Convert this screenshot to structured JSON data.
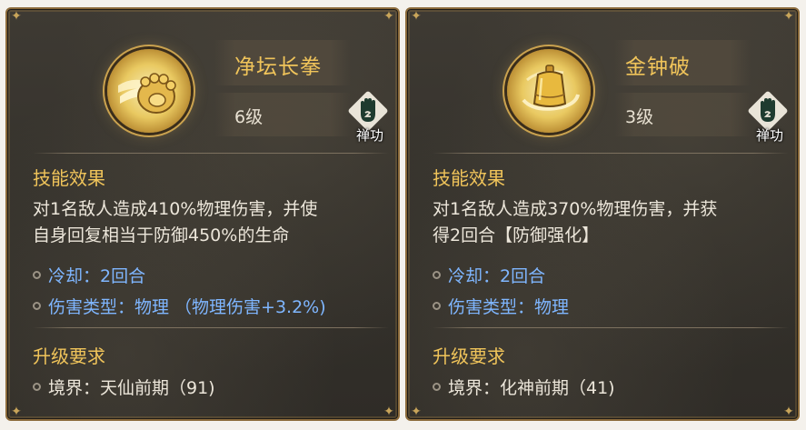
{
  "cards": [
    {
      "name": "净坛长拳",
      "level": "6级",
      "type_label": "禅功",
      "effect_title": "技能效果",
      "effect_lines": [
        "对1名敌人造成410%物理伤害，并使",
        "自身回复相当于防御450%的生命"
      ],
      "cooldown": "冷却：2回合",
      "damage_type": "伤害类型：物理  （物理伤害+3.2%)",
      "upgrade_title": "升级要求",
      "requirement": "境界：天仙前期（91)",
      "skill_icon": "paw-fist-icon",
      "type_icon": "hand-icon"
    },
    {
      "name": "金钟破",
      "level": "3级",
      "type_label": "禅功",
      "effect_title": "技能效果",
      "effect_lines": [
        "对1名敌人造成370%物理伤害，并获",
        "得2回合【防御强化】"
      ],
      "cooldown": "冷却：2回合",
      "damage_type": "伤害类型：物理",
      "upgrade_title": "升级要求",
      "requirement": "境界：化神前期（41)",
      "skill_icon": "golden-bell-icon",
      "type_icon": "hand-icon"
    }
  ],
  "colors": {
    "title_gold": "#f0c45a",
    "body_text": "#ece6da",
    "stat_blue": "#7fb6ff",
    "panel_bg": "#35322c",
    "border": "#8b6a3a"
  }
}
